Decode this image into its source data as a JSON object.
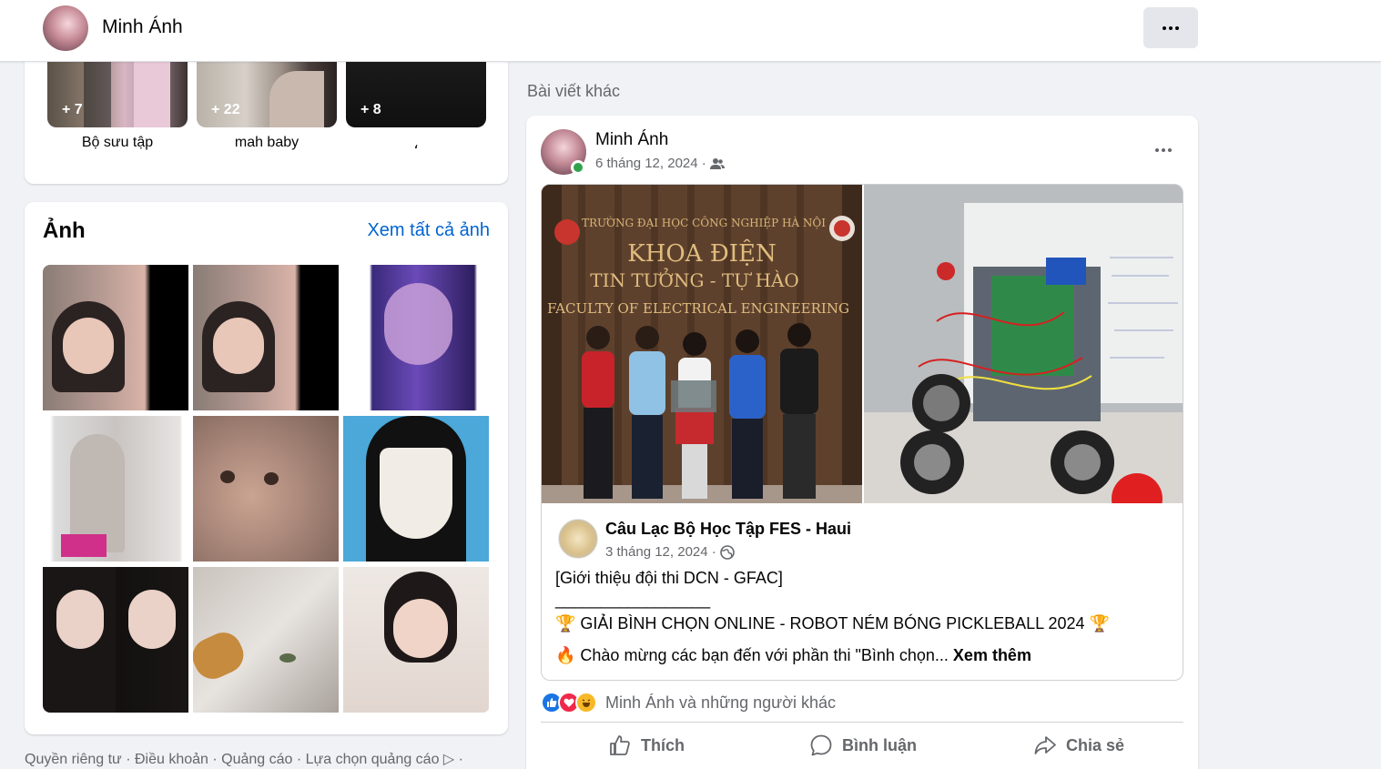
{
  "header": {
    "profile_name": "Minh Ánh"
  },
  "albums": [
    {
      "label": "Bộ sưu tập",
      "count": "+ 7"
    },
    {
      "label": "mah baby",
      "count": "+ 22"
    },
    {
      "label": "،",
      "count": "+ 8"
    }
  ],
  "photos": {
    "title": "Ảnh",
    "see_all": "Xem tất cả ảnh",
    "count": 9
  },
  "footer": {
    "links": "Quyền riêng tư · Điều khoản · Quảng cáo · Lựa chọn quảng cáo ▷ ·"
  },
  "other_posts": {
    "label": "Bài viết khác",
    "post": {
      "author": "Minh Ánh",
      "date": "6 tháng 12, 2024 ·",
      "shared": {
        "page_name": "Câu Lạc Bộ Học Tập FES - Haui",
        "date": "3 tháng 12, 2024 ·",
        "image_text": {
          "school": "TRƯỜNG ĐẠI HỌC CÔNG NGHIỆP HÀ NỘI",
          "line1": "KHOA ĐIỆN",
          "line2": "TIN TƯỞNG - TỰ HÀO",
          "line3": "FACULTY OF ELECTRICAL ENGINEERING"
        },
        "text_line1": "[Giới thiệu đội thi DCN - GFAC]",
        "text_line2": "_________________",
        "text_line3": "🏆 GIẢI BÌNH CHỌN ONLINE - ROBOT NÉM BÓNG PICKLEBALL 2024 🏆",
        "text_line4": "🔥 Chào mừng các bạn đến với phần thi \"Bình chọn...",
        "see_more": "Xem thêm"
      },
      "reactions_text": "Minh Ánh và những người khác",
      "actions": {
        "like": "Thích",
        "comment": "Bình luận",
        "share": "Chia sẻ"
      }
    }
  },
  "colors": {
    "link_blue": "#0064d1",
    "secondary_text": "#65676b",
    "online_green": "#31a24c"
  }
}
